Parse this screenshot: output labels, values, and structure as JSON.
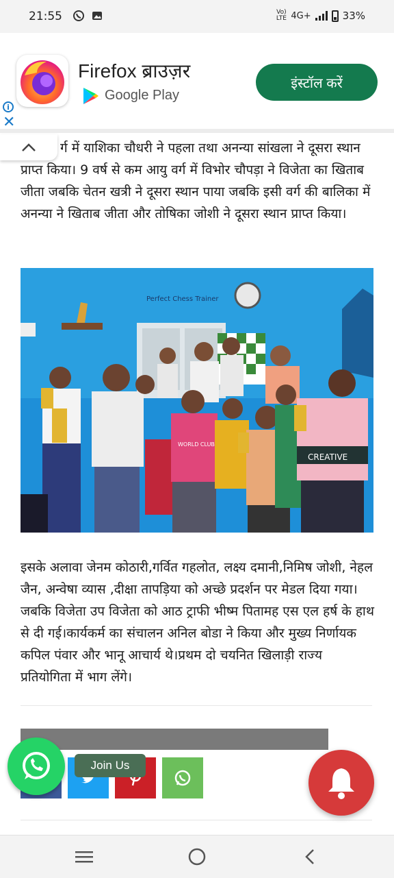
{
  "status_bar": {
    "time": "21:55",
    "network": "4G+",
    "volte": "Vo) LTE",
    "battery": "33%"
  },
  "ad": {
    "title": "Firefox ब्राउज़र",
    "store": "Google Play",
    "install_label": "इंस्टॉल करें",
    "info_icon": "i",
    "close_icon": "✕",
    "brand_color": "#147a4e"
  },
  "article": {
    "paragraph_1": "र्ग में याशिका चौधरी ने पहला तथा अनन्या सांखला ने दूसरा स्थान प्राप्त किया। 9 वर्ष से कम आयु वर्ग में विभोर चौपड़ा ने विजेता का खिताब जीता जबकि चेतन खत्री ने दूसरा स्थान पाया जबकि इसी वर्ग की बालिका में अनन्या ने खिताब जीता और तोषिका जोशी ने दूसरा स्थान प्राप्त किया।",
    "photo_sign": "Perfect Chess Trainer",
    "photo_shirt_1": "CREATIVE",
    "photo_shirt_2": "WORLD CLUB",
    "paragraph_2": "इसके अलावा जेनम कोठारी,गर्वित गहलोत, लक्ष्य दमानी,निमिष जोशी, नेहल जैन, अन्वेषा व्यास ,दीक्षा तापड़िया को अच्छे प्रदर्शन पर मेडल दिया गया।जबकि विजेता उप विजेता को आठ ट्राफी भीष्म पितामह एस एल हर्ष के हाथ से दी गई।कार्यकर्म का संचालन अनिल बोडा ने किया और मुख्य निर्णायक कपिल पंवार और भानू आचार्य थे।प्रथम दो चयनित खिलाड़ी राज्य प्रतियोगिता में भाग लेंगे।"
  },
  "floating": {
    "join_label": "Join Us"
  },
  "share": {
    "colors": [
      "#3b5998",
      "#1da1f2",
      "#cb2027",
      "#6cbf5b"
    ]
  }
}
